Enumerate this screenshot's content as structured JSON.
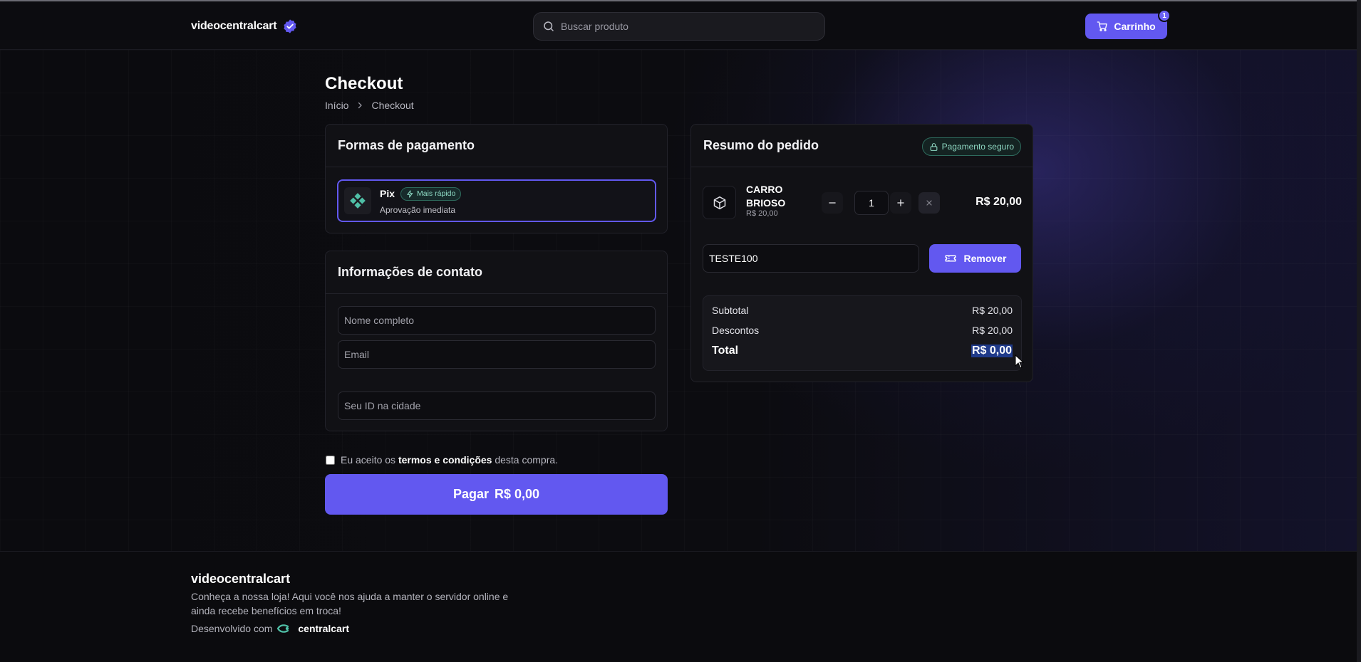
{
  "header": {
    "brand": "videocentralcart",
    "search_placeholder": "Buscar produto",
    "cart_label": "Carrinho",
    "cart_count": "1"
  },
  "page": {
    "title": "Checkout",
    "breadcrumb": [
      "Início",
      "Checkout"
    ]
  },
  "payment": {
    "title": "Formas de pagamento",
    "method_name": "Pix",
    "method_badge": "Mais rápido",
    "method_desc": "Aprovação imediata"
  },
  "contact": {
    "title": "Informações de contato",
    "name_placeholder": "Nome completo",
    "email_placeholder": "Email",
    "id_placeholder": "Seu ID na cidade"
  },
  "terms": {
    "prefix": "Eu aceito os",
    "link": "termos e condições",
    "suffix": "desta compra."
  },
  "pay_button": {
    "label": "Pagar",
    "amount": "R$ 0,00"
  },
  "summary": {
    "title": "Resumo do pedido",
    "secure_label": "Pagamento seguro",
    "item": {
      "name": "CARRO BRIOSO",
      "unit_price": "R$ 20,00",
      "quantity": "1",
      "total": "R$ 20,00"
    },
    "coupon_value": "TESTE100",
    "remove_label": "Remover",
    "subtotal_label": "Subtotal",
    "subtotal_value": "R$ 20,00",
    "discount_label": "Descontos",
    "discount_value": "R$ 20,00",
    "total_label": "Total",
    "total_value": "R$ 0,00"
  },
  "footer": {
    "brand": "videocentralcart",
    "desc": "Conheça a nossa loja! Aqui você nos ajuda a manter o servidor online e ainda recebe benefícios em troca!",
    "dev_prefix": "Desenvolvido com",
    "dev_brand": "centralcart"
  },
  "colors": {
    "accent": "#6258f0",
    "success": "#8fd9c3",
    "background": "#0a0a0d"
  },
  "icons": [
    "verified-icon",
    "search-icon",
    "cart-icon",
    "chevron-right-icon",
    "pix-icon",
    "zap-icon",
    "lock-icon",
    "package-icon",
    "minus-icon",
    "plus-icon",
    "close-icon",
    "ticket-icon",
    "cursor-icon",
    "centralcart-logo-icon"
  ]
}
